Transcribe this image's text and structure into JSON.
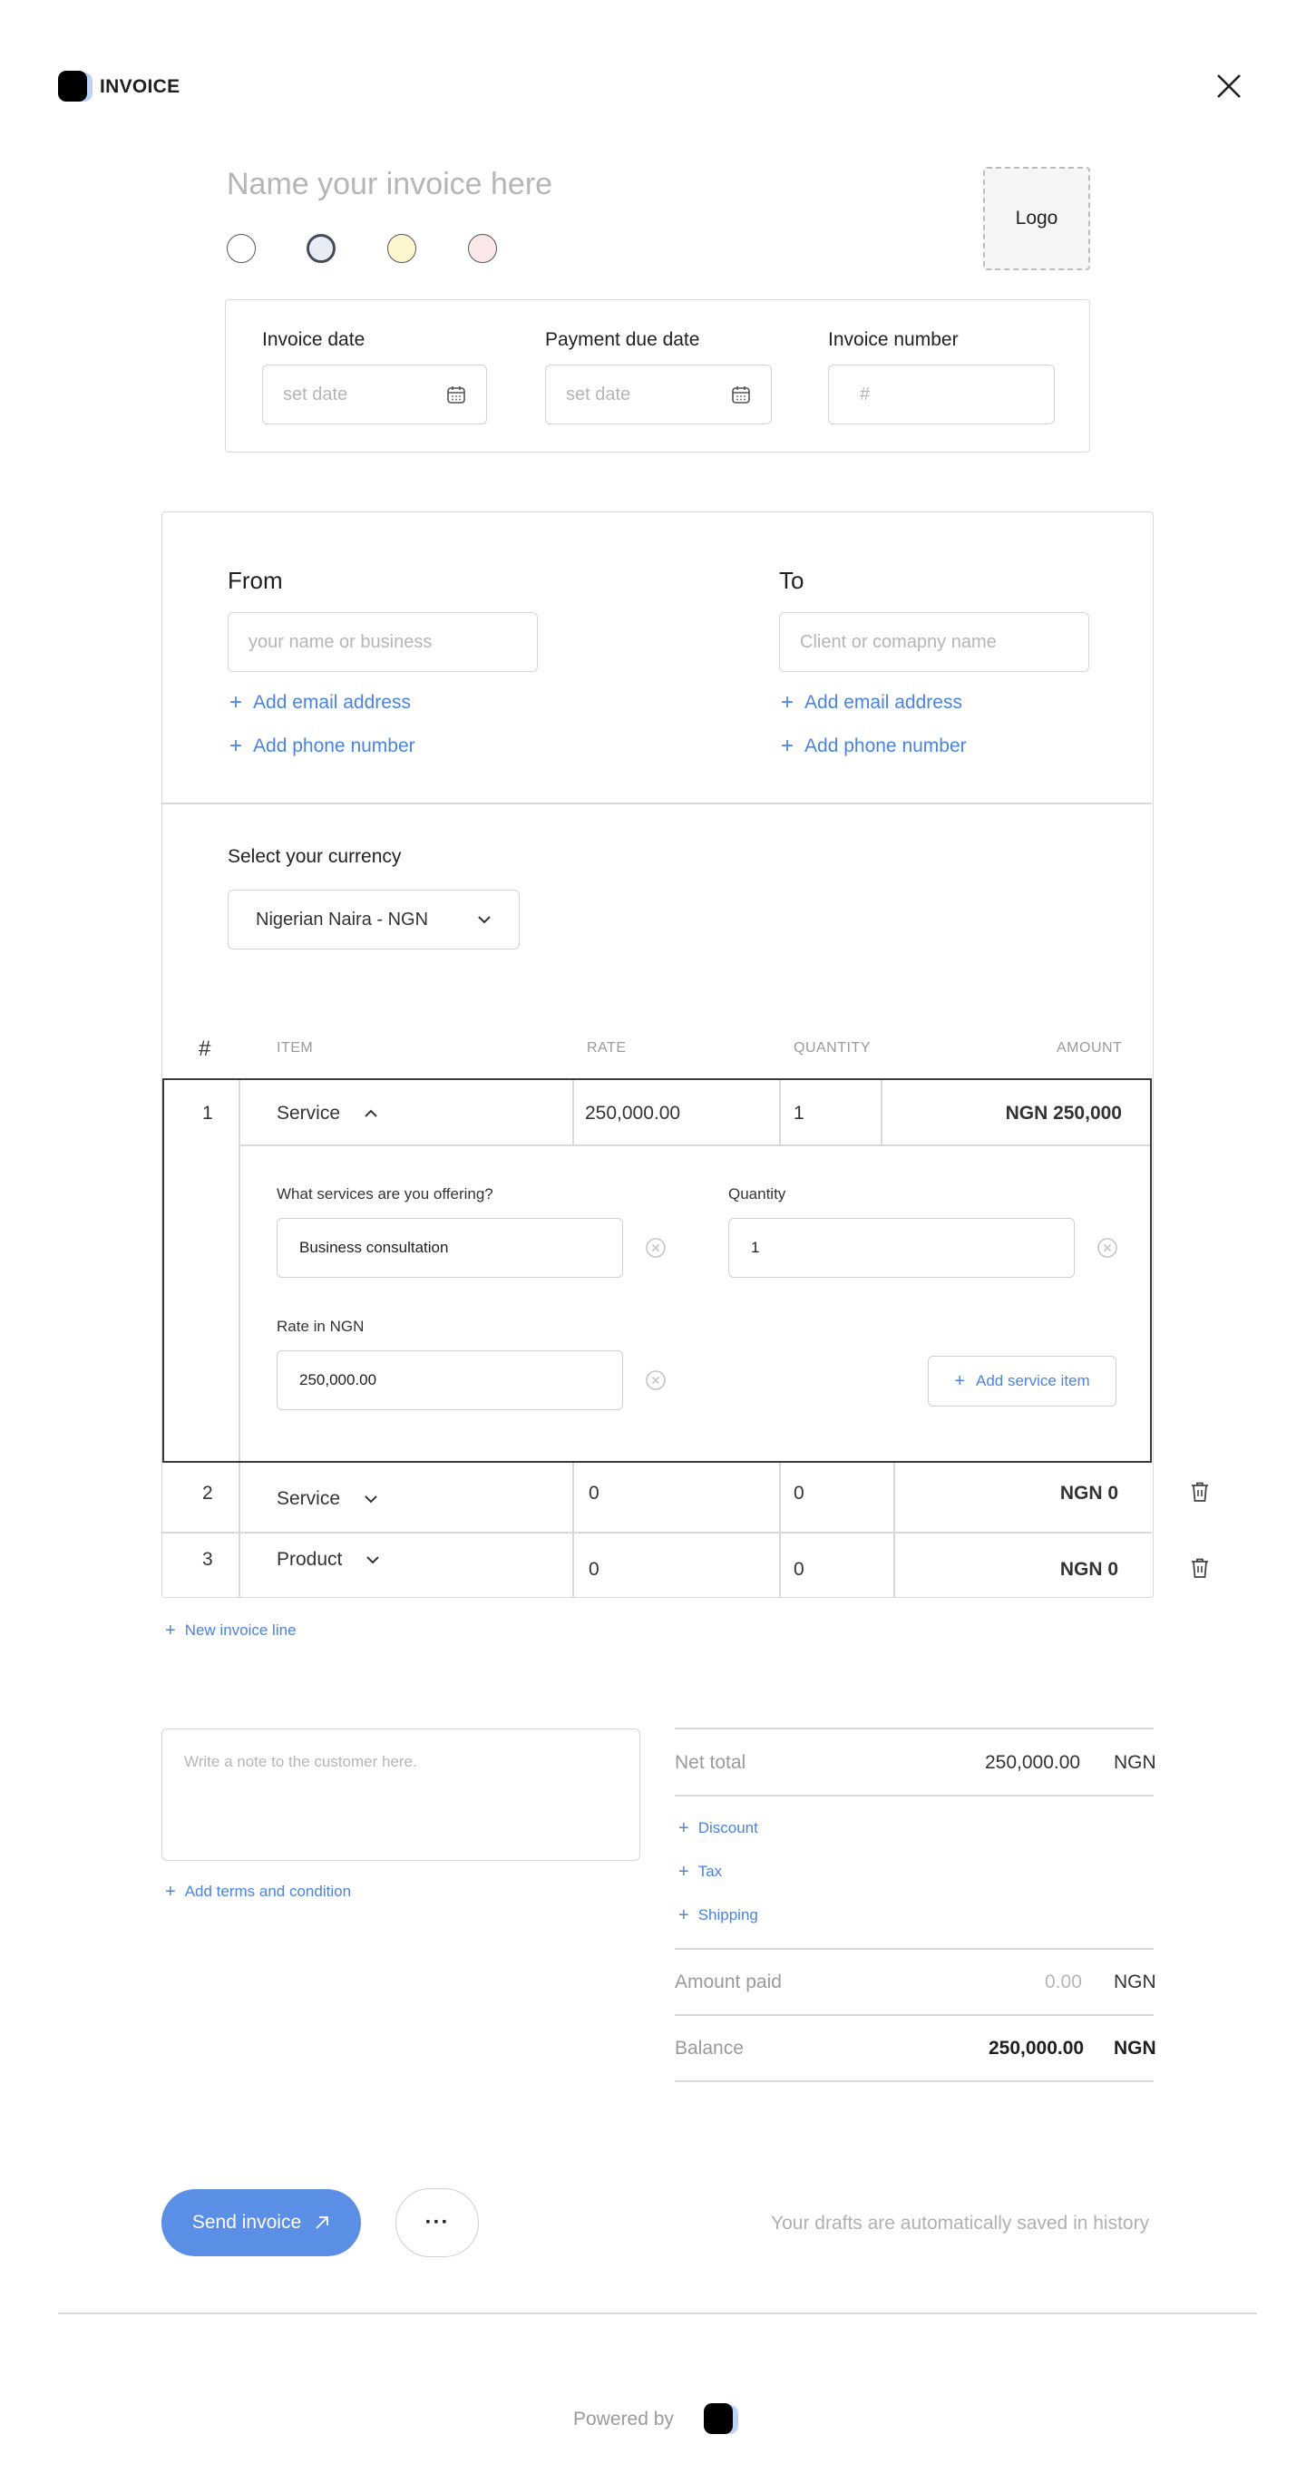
{
  "header": {
    "brand_name": "INVOICE",
    "close_icon": "close-icon"
  },
  "invoice": {
    "name_placeholder": "Name your invoice here",
    "logo_label": "Logo",
    "swatches": [
      "#ffffff",
      "#e8edf5",
      "#fdf6cf",
      "#fbe9ea"
    ],
    "selected_swatch": 1
  },
  "dates": {
    "invoice_date_label": "Invoice date",
    "invoice_date_placeholder": "set date",
    "due_date_label": "Payment due date",
    "due_date_placeholder": "set date",
    "invoice_number_label": "Invoice number",
    "invoice_number_placeholder": "#"
  },
  "parties": {
    "from_title": "From",
    "from_placeholder": "your name or business",
    "to_title": "To",
    "to_placeholder": "Client or comapny name",
    "add_email": "Add email address",
    "add_phone": "Add phone number"
  },
  "currency": {
    "label": "Select your currency",
    "selected": "Nigerian Naira - NGN"
  },
  "table": {
    "headers": {
      "num": "#",
      "item": "ITEM",
      "rate": "RATE",
      "quantity": "QUANTITY",
      "amount": "AMOUNT"
    },
    "rows": [
      {
        "num": "1",
        "item": "Service",
        "rate": "250,000.00",
        "quantity": "1",
        "amount": "NGN 250,000",
        "expanded": true
      },
      {
        "num": "2",
        "item": "Service",
        "rate": "0",
        "quantity": "0",
        "amount": "NGN 0"
      },
      {
        "num": "3",
        "item": "Product",
        "rate": "0",
        "quantity": "0",
        "amount": "NGN 0"
      }
    ],
    "detail": {
      "services_label": "What services are you offering?",
      "services_value": "Business consultation",
      "quantity_label": "Quantity",
      "quantity_value": "1",
      "rate_label": "Rate in NGN",
      "rate_value": "250,000.00",
      "add_service": "Add service item"
    },
    "new_line": "New invoice line"
  },
  "notes": {
    "placeholder": "Write a note to the customer here.",
    "add_terms": "Add terms and condition"
  },
  "totals": {
    "net_label": "Net total",
    "net_value": "250,000.00",
    "currency": "NGN",
    "discount": "Discount",
    "tax": "Tax",
    "shipping": "Shipping",
    "paid_label": "Amount paid",
    "paid_value": "0.00",
    "balance_label": "Balance",
    "balance_value": "250,000.00"
  },
  "actions": {
    "send": "Send invoice",
    "more": "···",
    "drafts_note": "Your drafts are automatically saved in history"
  },
  "footer": {
    "powered_by": "Powered by"
  },
  "colors": {
    "accent": "#4a83e0",
    "send_button": "#5b8fe6"
  }
}
